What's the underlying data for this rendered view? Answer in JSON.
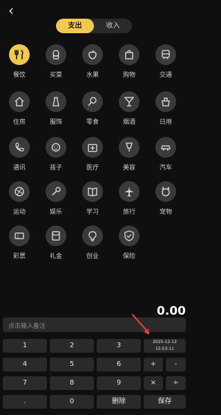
{
  "header": {
    "back_icon": "chevron-left-icon",
    "tabs": [
      {
        "label": "支出",
        "active": true
      },
      {
        "label": "收入",
        "active": false
      }
    ]
  },
  "categories": [
    {
      "label": "餐饮",
      "icon": "utensils-icon",
      "selected": true
    },
    {
      "label": "买菜",
      "icon": "vegetables-icon"
    },
    {
      "label": "水果",
      "icon": "apple-icon"
    },
    {
      "label": "购物",
      "icon": "shopping-bag-icon"
    },
    {
      "label": "交通",
      "icon": "bus-icon"
    },
    {
      "label": "住房",
      "icon": "house-icon"
    },
    {
      "label": "服饰",
      "icon": "clothes-icon"
    },
    {
      "label": "零食",
      "icon": "lollipop-icon"
    },
    {
      "label": "烟酒",
      "icon": "cocktail-glass-icon"
    },
    {
      "label": "日用",
      "icon": "daily-goods-icon"
    },
    {
      "label": "通讯",
      "icon": "phone-icon"
    },
    {
      "label": "孩子",
      "icon": "child-icon"
    },
    {
      "label": "医疗",
      "icon": "medical-kit-icon"
    },
    {
      "label": "美容",
      "icon": "beauty-icon"
    },
    {
      "label": "汽车",
      "icon": "car-icon"
    },
    {
      "label": "运动",
      "icon": "basketball-icon"
    },
    {
      "label": "娱乐",
      "icon": "microphone-icon"
    },
    {
      "label": "学习",
      "icon": "book-icon"
    },
    {
      "label": "旅行",
      "icon": "airplane-icon"
    },
    {
      "label": "宠物",
      "icon": "pet-icon"
    },
    {
      "label": "彩票",
      "icon": "ticket-icon"
    },
    {
      "label": "礼金",
      "icon": "red-envelope-icon"
    },
    {
      "label": "创业",
      "icon": "lightbulb-icon"
    },
    {
      "label": "保险",
      "icon": "shield-icon"
    }
  ],
  "amount": "0.00",
  "note": {
    "placeholder": "点击输入备注"
  },
  "keypad": {
    "k1": "1",
    "k2": "2",
    "k3": "3",
    "k4": "4",
    "k5": "5",
    "k6": "6",
    "k7": "7",
    "k8": "8",
    "k9": "9",
    "dot": ".",
    "k0": "0",
    "delete": "删除",
    "save": "保存",
    "plus": "+",
    "minus": "-",
    "multiply": "×",
    "divide": "÷",
    "date": "2025-12-12",
    "time": "15:53:11"
  },
  "colors": {
    "accent": "#f2c94c",
    "background": "#0f0f0f",
    "arrow": "#e53935"
  }
}
